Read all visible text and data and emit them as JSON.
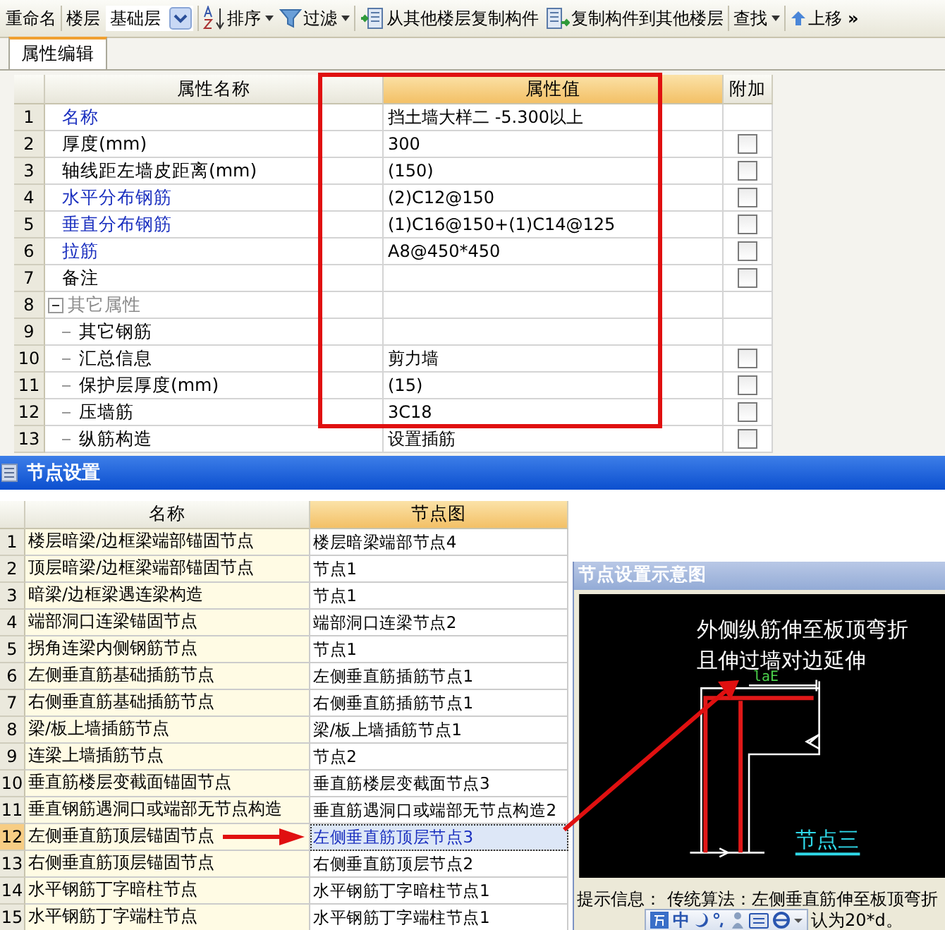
{
  "toolbar": {
    "rename": "重命名",
    "floor_label": "楼层",
    "floor_value": "基础层",
    "sort": "排序",
    "filter": "过滤",
    "copy_from": "从其他楼层复制构件",
    "copy_to": "复制构件到其他楼层",
    "find": "查找",
    "move_up": "上移",
    "overflow": "»"
  },
  "tabs": [
    {
      "label": "属性编辑",
      "selected": true
    }
  ],
  "property_grid": {
    "columns": [
      "属性名称",
      "属性值",
      "附加"
    ],
    "rows": [
      {
        "no": "1",
        "name": "名称",
        "value": "挡土墙大样二  -5.300以上",
        "emphasized": true
      },
      {
        "no": "2",
        "name": "厚度(mm)",
        "value": "300",
        "emphasized": false,
        "checked": false
      },
      {
        "no": "3",
        "name": "轴线距左墙皮距离(mm)",
        "value": "(150)",
        "emphasized": false,
        "checked": false
      },
      {
        "no": "4",
        "name": "水平分布钢筋",
        "value": "(2)C12@150",
        "emphasized": true,
        "checked": false
      },
      {
        "no": "5",
        "name": "垂直分布钢筋",
        "value": "(1)C16@150+(1)C14@125",
        "emphasized": true,
        "checked": false
      },
      {
        "no": "6",
        "name": "拉筋",
        "value": "A8@450*450",
        "emphasized": true,
        "checked": false
      },
      {
        "no": "7",
        "name": "备注",
        "emphasized": false,
        "checked": false
      },
      {
        "no": "8",
        "name": "其它属性",
        "expanded": true,
        "emphasized": false,
        "children": [
          {
            "no": "9",
            "name": "其它钢筋",
            "emphasized": false
          },
          {
            "no": "10",
            "name": "汇总信息",
            "value": "剪力墙",
            "emphasized": false,
            "checked": false
          },
          {
            "no": "11",
            "name": "保护层厚度(mm)",
            "value": "(15)",
            "emphasized": false,
            "checked": false
          },
          {
            "no": "12",
            "name": "压墙筋",
            "value": "3C18",
            "emphasized": false,
            "checked": false
          },
          {
            "no": "13",
            "name": "纵筋构造",
            "value": "设置插筋",
            "emphasized": false,
            "checked": false
          }
        ]
      }
    ]
  },
  "node_settings": {
    "title": "节点设置",
    "columns": [
      "名称",
      "节点图"
    ],
    "rows": [
      {
        "no": "1",
        "name": "楼层暗梁/边框梁端部锚固节点",
        "node": "楼层暗梁端部节点4",
        "selected": false
      },
      {
        "no": "2",
        "name": "顶层暗梁/边框梁端部锚固节点",
        "node": "节点1",
        "selected": false
      },
      {
        "no": "3",
        "name": "暗梁/边框梁遇连梁构造",
        "node": "节点1",
        "selected": false
      },
      {
        "no": "4",
        "name": "端部洞口连梁锚固节点",
        "node": "端部洞口连梁节点2",
        "selected": false
      },
      {
        "no": "5",
        "name": "拐角连梁内侧钢筋节点",
        "node": "节点1",
        "selected": false
      },
      {
        "no": "6",
        "name": "左侧垂直筋基础插筋节点",
        "node": "左侧垂直筋插筋节点1",
        "selected": false
      },
      {
        "no": "7",
        "name": "右侧垂直筋基础插筋节点",
        "node": "右侧垂直筋插筋节点1",
        "selected": false
      },
      {
        "no": "8",
        "name": "梁/板上墙插筋节点",
        "node": "梁/板上墙插筋节点1",
        "selected": false
      },
      {
        "no": "9",
        "name": "连梁上墙插筋节点",
        "node": "节点2",
        "selected": false
      },
      {
        "no": "10",
        "name": "垂直筋楼层变截面锚固节点",
        "node": "垂直筋楼层变截面节点3",
        "selected": false
      },
      {
        "no": "11",
        "name": "垂直钢筋遇洞口或端部无节点构造",
        "node": "垂直筋遇洞口或端部无节点构造2",
        "selected": false
      },
      {
        "no": "12",
        "name": "左侧垂直筋顶层锚固节点",
        "node": "左侧垂直筋顶层节点3",
        "selected": true
      },
      {
        "no": "13",
        "name": "右侧垂直筋顶层锚固节点",
        "node": "右侧垂直筋顶层节点2",
        "selected": false
      },
      {
        "no": "14",
        "name": "水平钢筋丁字暗柱节点",
        "node": "水平钢筋丁字暗柱节点1",
        "selected": false
      },
      {
        "no": "15",
        "name": "水平钢筋丁字端柱节点",
        "node": "水平钢筋丁字端柱节点1",
        "selected": false
      }
    ]
  },
  "diagram_panel": {
    "title": "节点设置示意图",
    "caption_lines": [
      "外侧纵筋伸至板顶弯折",
      "且伸过墙对边延伸"
    ],
    "dimension_label": "laE",
    "node_label": "节点三",
    "hint_lines": [
      "提示信息：  传统算法：左侧垂直筋伸至板顶弯折",
      "认为20*d。"
    ],
    "ime_mode": "中"
  }
}
